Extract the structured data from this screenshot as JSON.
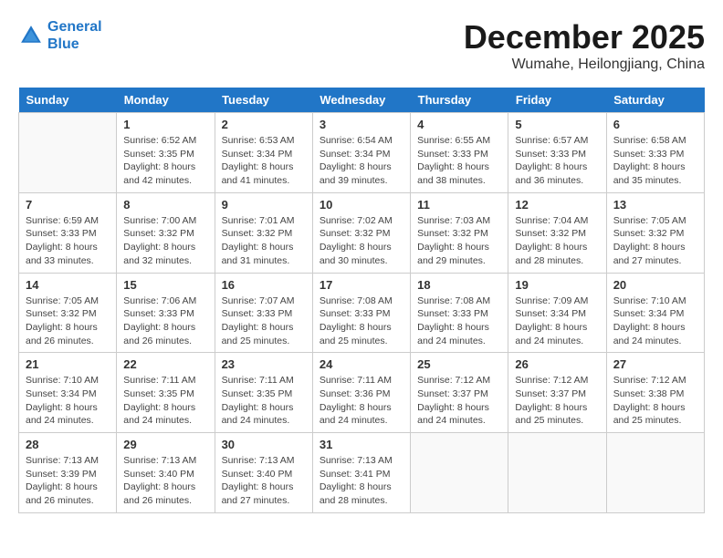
{
  "header": {
    "logo_line1": "General",
    "logo_line2": "Blue",
    "month": "December 2025",
    "location": "Wumahe, Heilongjiang, China"
  },
  "weekdays": [
    "Sunday",
    "Monday",
    "Tuesday",
    "Wednesday",
    "Thursday",
    "Friday",
    "Saturday"
  ],
  "weeks": [
    [
      {
        "day": "",
        "info": ""
      },
      {
        "day": "1",
        "info": "Sunrise: 6:52 AM\nSunset: 3:35 PM\nDaylight: 8 hours\nand 42 minutes."
      },
      {
        "day": "2",
        "info": "Sunrise: 6:53 AM\nSunset: 3:34 PM\nDaylight: 8 hours\nand 41 minutes."
      },
      {
        "day": "3",
        "info": "Sunrise: 6:54 AM\nSunset: 3:34 PM\nDaylight: 8 hours\nand 39 minutes."
      },
      {
        "day": "4",
        "info": "Sunrise: 6:55 AM\nSunset: 3:33 PM\nDaylight: 8 hours\nand 38 minutes."
      },
      {
        "day": "5",
        "info": "Sunrise: 6:57 AM\nSunset: 3:33 PM\nDaylight: 8 hours\nand 36 minutes."
      },
      {
        "day": "6",
        "info": "Sunrise: 6:58 AM\nSunset: 3:33 PM\nDaylight: 8 hours\nand 35 minutes."
      }
    ],
    [
      {
        "day": "7",
        "info": "Sunrise: 6:59 AM\nSunset: 3:33 PM\nDaylight: 8 hours\nand 33 minutes."
      },
      {
        "day": "8",
        "info": "Sunrise: 7:00 AM\nSunset: 3:32 PM\nDaylight: 8 hours\nand 32 minutes."
      },
      {
        "day": "9",
        "info": "Sunrise: 7:01 AM\nSunset: 3:32 PM\nDaylight: 8 hours\nand 31 minutes."
      },
      {
        "day": "10",
        "info": "Sunrise: 7:02 AM\nSunset: 3:32 PM\nDaylight: 8 hours\nand 30 minutes."
      },
      {
        "day": "11",
        "info": "Sunrise: 7:03 AM\nSunset: 3:32 PM\nDaylight: 8 hours\nand 29 minutes."
      },
      {
        "day": "12",
        "info": "Sunrise: 7:04 AM\nSunset: 3:32 PM\nDaylight: 8 hours\nand 28 minutes."
      },
      {
        "day": "13",
        "info": "Sunrise: 7:05 AM\nSunset: 3:32 PM\nDaylight: 8 hours\nand 27 minutes."
      }
    ],
    [
      {
        "day": "14",
        "info": "Sunrise: 7:05 AM\nSunset: 3:32 PM\nDaylight: 8 hours\nand 26 minutes."
      },
      {
        "day": "15",
        "info": "Sunrise: 7:06 AM\nSunset: 3:33 PM\nDaylight: 8 hours\nand 26 minutes."
      },
      {
        "day": "16",
        "info": "Sunrise: 7:07 AM\nSunset: 3:33 PM\nDaylight: 8 hours\nand 25 minutes."
      },
      {
        "day": "17",
        "info": "Sunrise: 7:08 AM\nSunset: 3:33 PM\nDaylight: 8 hours\nand 25 minutes."
      },
      {
        "day": "18",
        "info": "Sunrise: 7:08 AM\nSunset: 3:33 PM\nDaylight: 8 hours\nand 24 minutes."
      },
      {
        "day": "19",
        "info": "Sunrise: 7:09 AM\nSunset: 3:34 PM\nDaylight: 8 hours\nand 24 minutes."
      },
      {
        "day": "20",
        "info": "Sunrise: 7:10 AM\nSunset: 3:34 PM\nDaylight: 8 hours\nand 24 minutes."
      }
    ],
    [
      {
        "day": "21",
        "info": "Sunrise: 7:10 AM\nSunset: 3:34 PM\nDaylight: 8 hours\nand 24 minutes."
      },
      {
        "day": "22",
        "info": "Sunrise: 7:11 AM\nSunset: 3:35 PM\nDaylight: 8 hours\nand 24 minutes."
      },
      {
        "day": "23",
        "info": "Sunrise: 7:11 AM\nSunset: 3:35 PM\nDaylight: 8 hours\nand 24 minutes."
      },
      {
        "day": "24",
        "info": "Sunrise: 7:11 AM\nSunset: 3:36 PM\nDaylight: 8 hours\nand 24 minutes."
      },
      {
        "day": "25",
        "info": "Sunrise: 7:12 AM\nSunset: 3:37 PM\nDaylight: 8 hours\nand 24 minutes."
      },
      {
        "day": "26",
        "info": "Sunrise: 7:12 AM\nSunset: 3:37 PM\nDaylight: 8 hours\nand 25 minutes."
      },
      {
        "day": "27",
        "info": "Sunrise: 7:12 AM\nSunset: 3:38 PM\nDaylight: 8 hours\nand 25 minutes."
      }
    ],
    [
      {
        "day": "28",
        "info": "Sunrise: 7:13 AM\nSunset: 3:39 PM\nDaylight: 8 hours\nand 26 minutes."
      },
      {
        "day": "29",
        "info": "Sunrise: 7:13 AM\nSunset: 3:40 PM\nDaylight: 8 hours\nand 26 minutes."
      },
      {
        "day": "30",
        "info": "Sunrise: 7:13 AM\nSunset: 3:40 PM\nDaylight: 8 hours\nand 27 minutes."
      },
      {
        "day": "31",
        "info": "Sunrise: 7:13 AM\nSunset: 3:41 PM\nDaylight: 8 hours\nand 28 minutes."
      },
      {
        "day": "",
        "info": ""
      },
      {
        "day": "",
        "info": ""
      },
      {
        "day": "",
        "info": ""
      }
    ]
  ]
}
